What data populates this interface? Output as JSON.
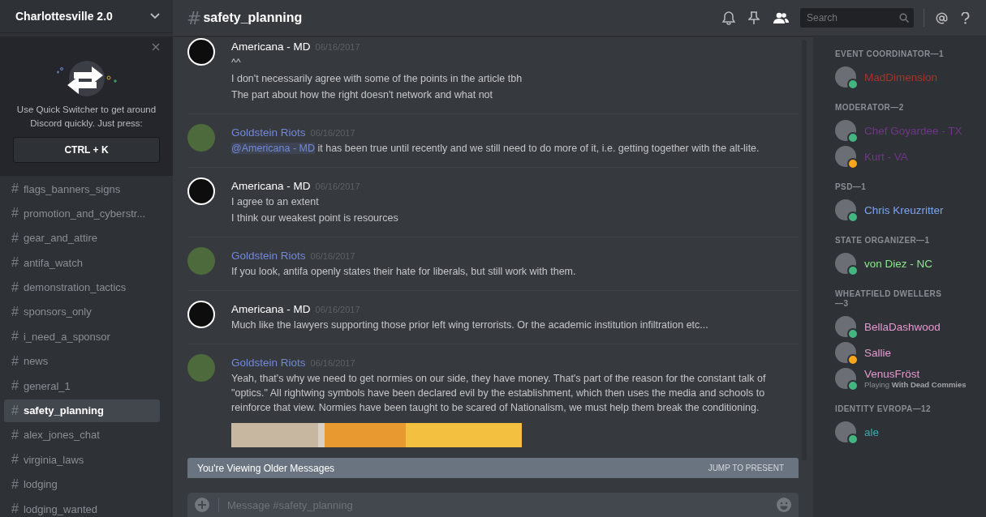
{
  "server": {
    "name": "Charlottesville 2.0"
  },
  "quick_switcher": {
    "text": "Use Quick Switcher to get around Discord quickly. Just press:",
    "shortcut": "CTRL + K"
  },
  "channels": [
    {
      "hash": "#",
      "name": "flags_banners_signs",
      "selected": false
    },
    {
      "hash": "#",
      "name": "promotion_and_cyberstr...",
      "selected": false
    },
    {
      "hash": "#",
      "name": "gear_and_attire",
      "selected": false
    },
    {
      "hash": "#",
      "name": "antifa_watch",
      "selected": false
    },
    {
      "hash": "#",
      "name": "demonstration_tactics",
      "selected": false
    },
    {
      "hash": "#",
      "name": "sponsors_only",
      "selected": false
    },
    {
      "hash": "#",
      "name": "i_need_a_sponsor",
      "selected": false
    },
    {
      "hash": "#",
      "name": "news",
      "selected": false
    },
    {
      "hash": "#",
      "name": "general_1",
      "selected": false
    },
    {
      "hash": "#",
      "name": "safety_planning",
      "selected": true
    },
    {
      "hash": "#",
      "name": "alex_jones_chat",
      "selected": false
    },
    {
      "hash": "#",
      "name": "virginia_laws",
      "selected": false
    },
    {
      "hash": "#",
      "name": "lodging",
      "selected": false
    },
    {
      "hash": "#",
      "name": "lodging_wanted",
      "selected": false
    }
  ],
  "header": {
    "hash": "#",
    "channel": "safety_planning",
    "search_placeholder": "Search"
  },
  "messages": [
    {
      "author": "Americana - MD",
      "time": "06/16/2017",
      "color": "#ffffff",
      "emblem_avatar": true,
      "lines": [
        "^^",
        "I don't necessarily agree with some of the points in the article tbh",
        "The part about how the right doesn't network and what not"
      ]
    },
    {
      "author": "Goldstein Riots",
      "time": "06/16/2017",
      "color": "#7289da",
      "emblem_avatar": false,
      "mention": "@Americana - MD",
      "lines": [
        "it has been true until recently and we still need to do more of it, i.e. getting together with the alt-lite."
      ]
    },
    {
      "author": "Americana - MD",
      "time": "06/16/2017",
      "color": "#ffffff",
      "emblem_avatar": true,
      "lines": [
        "I agree to an extent",
        "I think our weakest point is resources"
      ]
    },
    {
      "author": "Goldstein Riots",
      "time": "06/16/2017",
      "color": "#7289da",
      "emblem_avatar": false,
      "lines": [
        "If you look, antifa openly states their hate for liberals, but still work with them."
      ]
    },
    {
      "author": "Americana - MD",
      "time": "06/16/2017",
      "color": "#ffffff",
      "emblem_avatar": true,
      "lines": [
        "Much like the lawyers supporting those prior left wing terrorists. Or the academic institution infiltration etc..."
      ]
    },
    {
      "author": "Goldstein Riots",
      "time": "06/16/2017",
      "color": "#7289da",
      "emblem_avatar": false,
      "lines": [
        "Yeah, that's why we need to get normies on our side, they have money.  That's part of the reason for the constant talk of \"optics.\"  All rightwing symbols have been declared evil by the establishment, which then uses the media and schools to reinforce that view.  Normies have been taught to be scared of Nationalism, we must help them break the conditioning."
      ],
      "attachment": true
    }
  ],
  "older_bar": {
    "text": "You're Viewing Older Messages",
    "action": "JUMP TO PRESENT"
  },
  "composer": {
    "placeholder": "Message #safety_planning"
  },
  "member_groups": [
    {
      "role": "EVENT COORDINATOR—1",
      "members": [
        {
          "name": "MadDimension",
          "color": "#a8342a",
          "idle": false
        }
      ]
    },
    {
      "role": "MODERATOR—2",
      "members": [
        {
          "name": "Chef Goyardee - TX",
          "color": "#71368a",
          "idle": false
        },
        {
          "name": "Kurt - VA",
          "color": "#71368a",
          "idle": true
        }
      ]
    },
    {
      "role": "PSD—1",
      "members": [
        {
          "name": "Chris Kreuzritter",
          "color": "#7ba6ee",
          "idle": false
        }
      ]
    },
    {
      "role": "STATE ORGANIZER—1",
      "members": [
        {
          "name": "von Diez - NC",
          "color": "#8ee68e",
          "idle": false
        }
      ]
    },
    {
      "role": "WHEATFIELD DWELLERS—3",
      "members": [
        {
          "name": "BellaDashwood",
          "color": "#e59ad0",
          "idle": false
        },
        {
          "name": "Sallie",
          "color": "#e59ad0",
          "idle": true
        },
        {
          "name": "VenusFröst",
          "color": "#e59ad0",
          "idle": false,
          "activity": "Playing **With Dead Commies**"
        }
      ]
    },
    {
      "role": "IDENTITY EVROPA—12",
      "members": [
        {
          "name": "ale",
          "color": "#3fa8b0",
          "idle": false
        }
      ]
    }
  ]
}
